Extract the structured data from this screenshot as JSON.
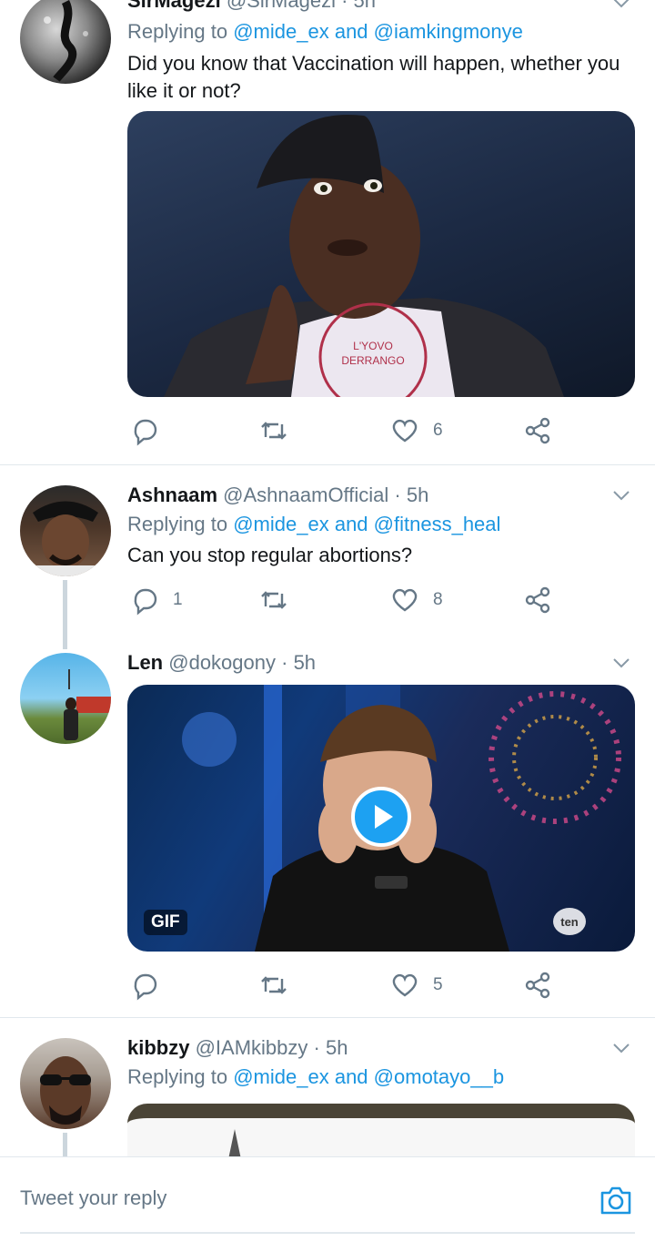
{
  "tweets": [
    {
      "name": "SirMagezi",
      "handle": "@SirMagezi",
      "time": "· 5h",
      "replying_prefix": "Replying to",
      "mention1": "@mide_ex",
      "and": "and",
      "mention2": "@iamkingmonye",
      "text": "Did you know that Vaccination will happen, whether you like it or not?",
      "media_type": "image",
      "shirt_text1": "L'YOVO",
      "shirt_text2": "DERRANGO",
      "reply_count": "",
      "retweet_count": "",
      "like_count": "6"
    },
    {
      "name": "Ashnaam",
      "handle": "@AshnaamOfficial",
      "time": "· 5h",
      "replying_prefix": "Replying to",
      "mention1": "@mide_ex",
      "and": "and",
      "mention2": "@fitness_heal",
      "text": "Can you stop regular abortions?",
      "reply_count": "1",
      "retweet_count": "",
      "like_count": "8"
    },
    {
      "name": "Len",
      "handle": "@dokogony",
      "time": "· 5h",
      "media_type": "gif",
      "gif_label": "GIF",
      "watermark": "ten",
      "reply_count": "",
      "retweet_count": "",
      "like_count": "5"
    },
    {
      "name": "kibbzy",
      "handle": "@IAMkibbzy",
      "time": "· 5h",
      "replying_prefix": "Replying to",
      "mention1": "@mide_ex",
      "and": "and",
      "mention2": "@omotayo__b"
    }
  ],
  "reply_bar": {
    "placeholder": "Tweet your reply",
    "camera_icon": "camera-icon"
  },
  "colors": {
    "accent": "#1b95e0",
    "secondary_text": "#657786",
    "divider": "#e1e8ed"
  }
}
